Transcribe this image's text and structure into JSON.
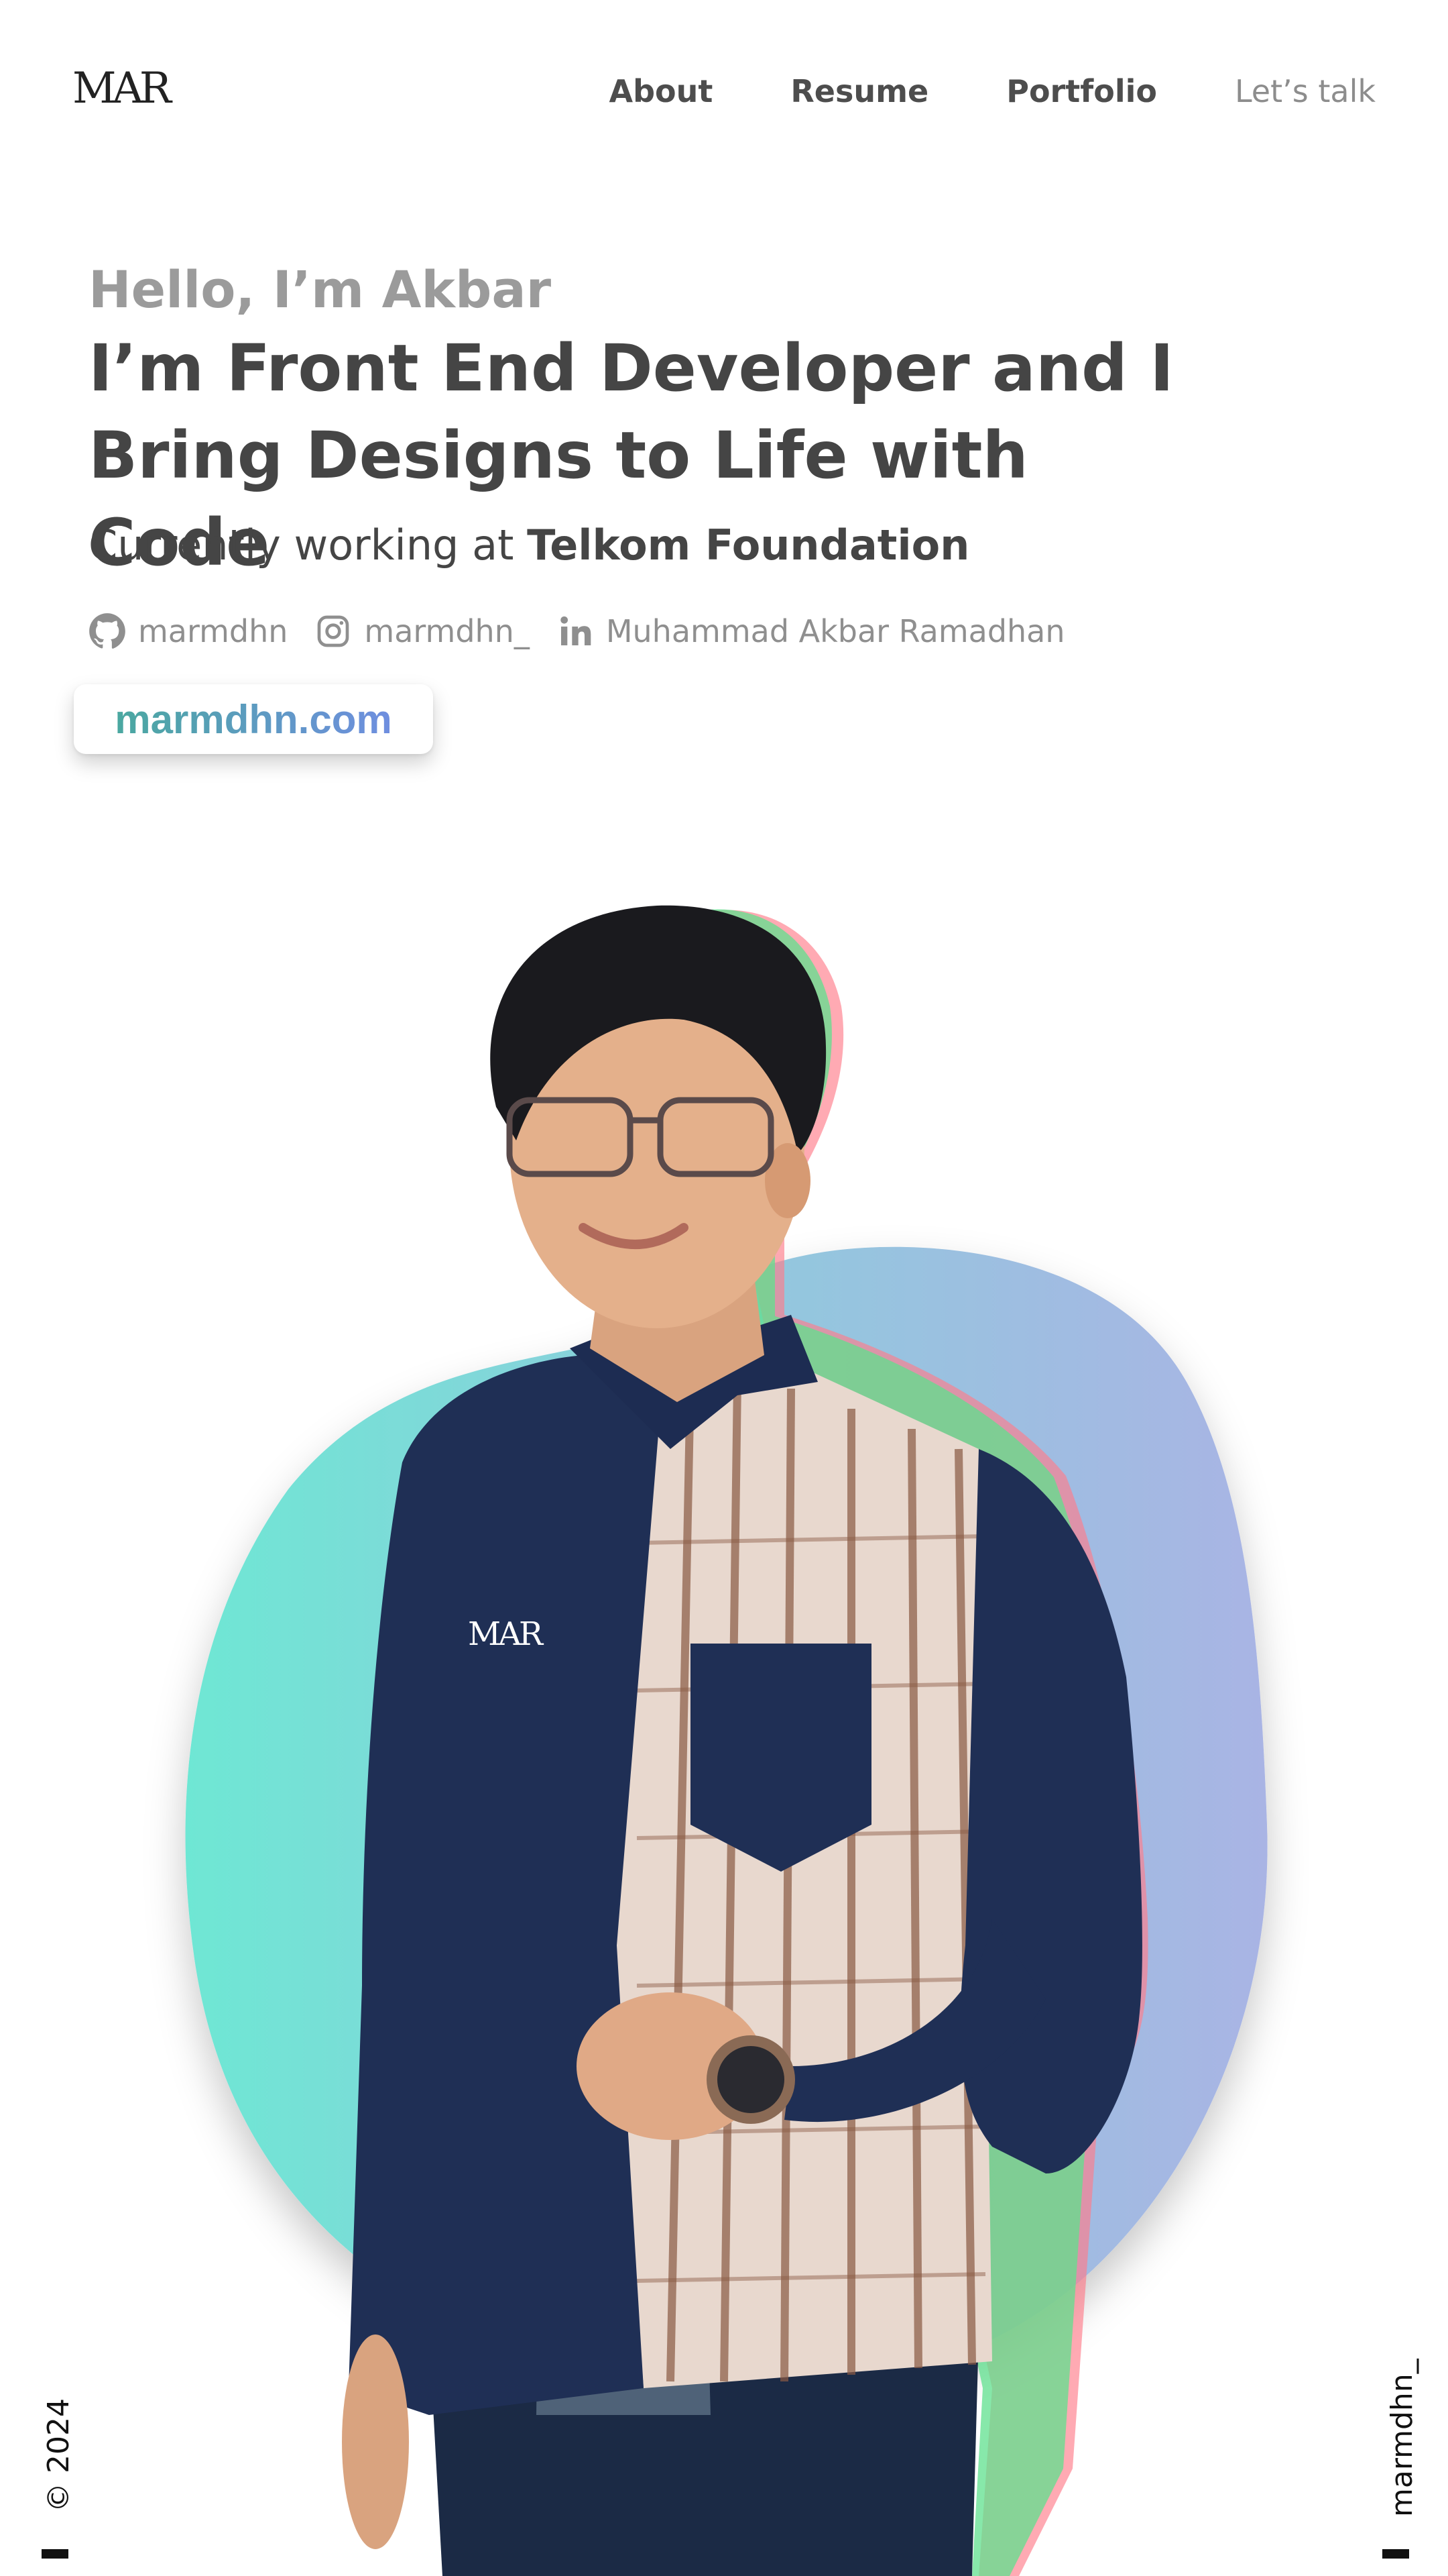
{
  "header": {
    "logo_text": "MAR",
    "nav": [
      {
        "label": "About"
      },
      {
        "label": "Resume"
      },
      {
        "label": "Portfolio"
      },
      {
        "label": "Let’s talk"
      }
    ]
  },
  "intro": {
    "greeting": "Hello, I’m Akbar",
    "headline_line1": "I’m Front End Developer and I",
    "headline_line2": "Bring Designs to Life with Code",
    "working_prefix": "Currently working at",
    "company": "Telkom Foundation"
  },
  "socials": [
    {
      "icon": "github-icon",
      "label": "marmdhn"
    },
    {
      "icon": "instagram-icon",
      "label": "marmdhn_"
    },
    {
      "icon": "linkedin-icon",
      "label": "Muhammad Akbar Ramadhan"
    }
  ],
  "site_badge": {
    "label": "marmdhn.com"
  },
  "hero": {
    "shirt_logo": "MAR",
    "blob_colors": [
      "#6ee7d4",
      "#a9b4e4"
    ]
  },
  "side": {
    "left": "© 2024",
    "right": "marmdhn_"
  }
}
